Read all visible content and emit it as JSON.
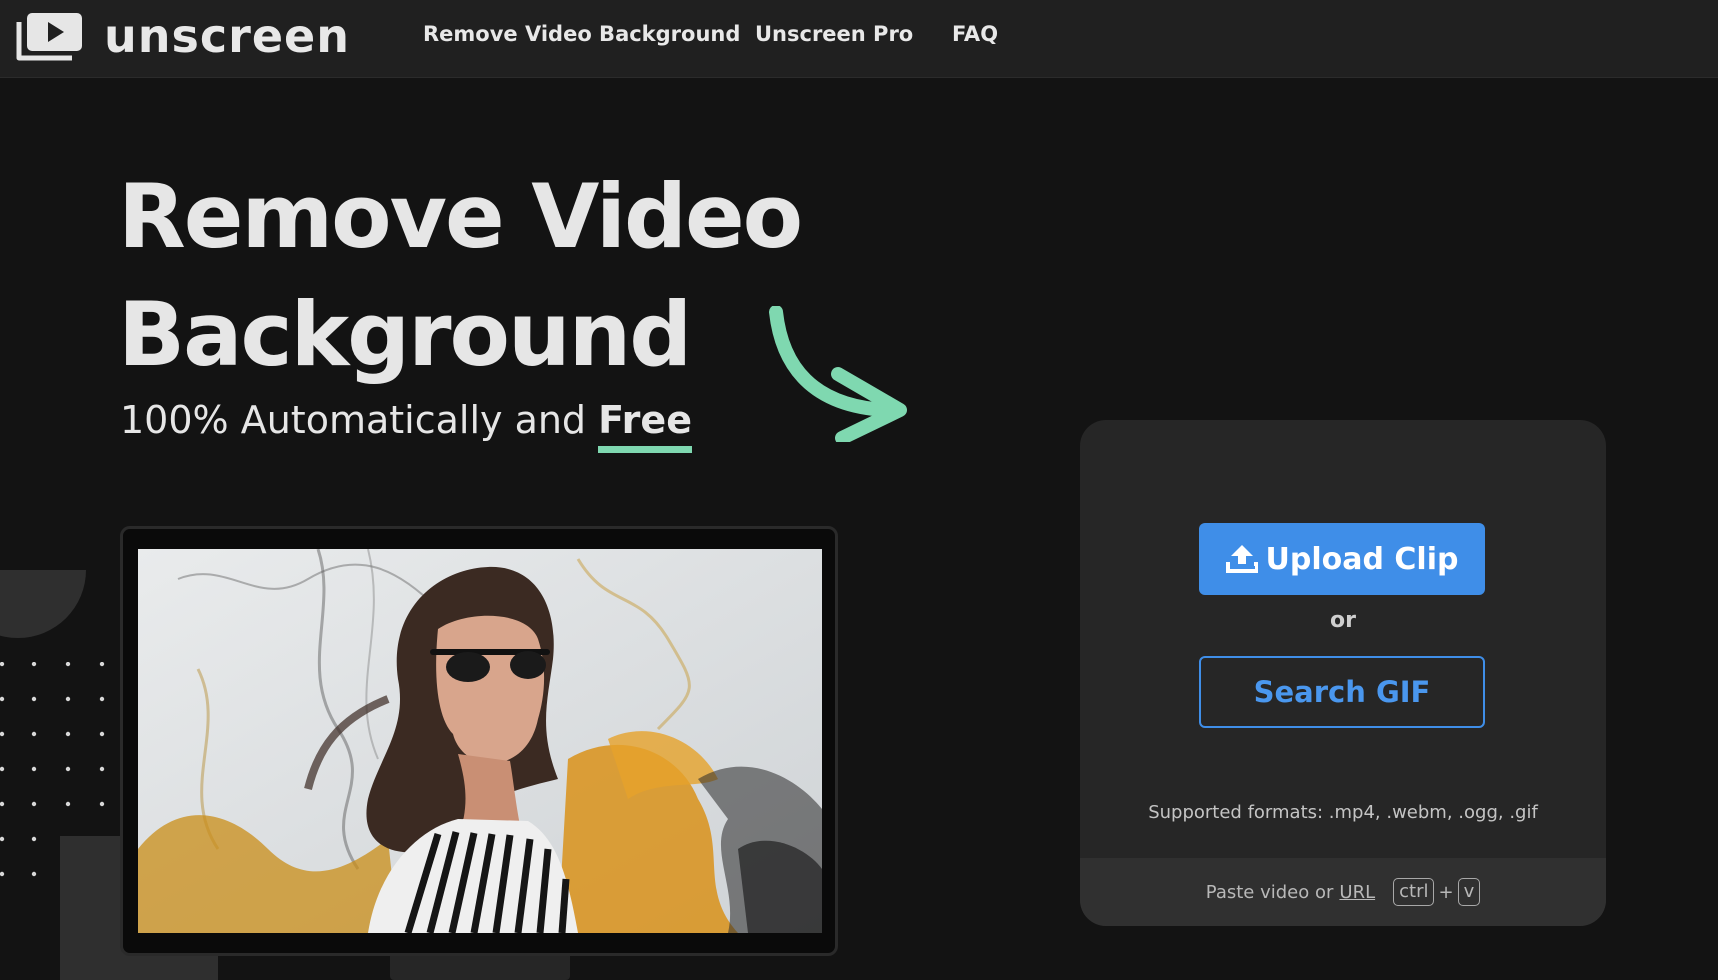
{
  "nav": {
    "brand": "unscreen",
    "links": [
      "Remove Video Background",
      "Unscreen Pro",
      "FAQ"
    ]
  },
  "hero": {
    "title_line1": "Remove Video",
    "title_line2": "Background",
    "subtitle_prefix": "100% Automatically and",
    "subtitle_emphasis": "Free"
  },
  "upload": {
    "upload_button": "Upload Clip",
    "or_text": "or",
    "search_button": "Search GIF",
    "supported_formats": "Supported formats: .mp4, .webm, .ogg, .gif",
    "paste_prefix": "Paste video or",
    "paste_link": "URL",
    "key_ctrl": "ctrl",
    "key_plus": "+",
    "key_v": "v"
  },
  "colors": {
    "accent_blue": "#3f8ee8",
    "accent_green": "#7fd8b0",
    "background": "#131313",
    "nav_background": "#202020",
    "card_background": "#262626"
  },
  "icons": [
    "unscreen-logo-icon",
    "upload-icon",
    "curved-arrow-icon"
  ]
}
